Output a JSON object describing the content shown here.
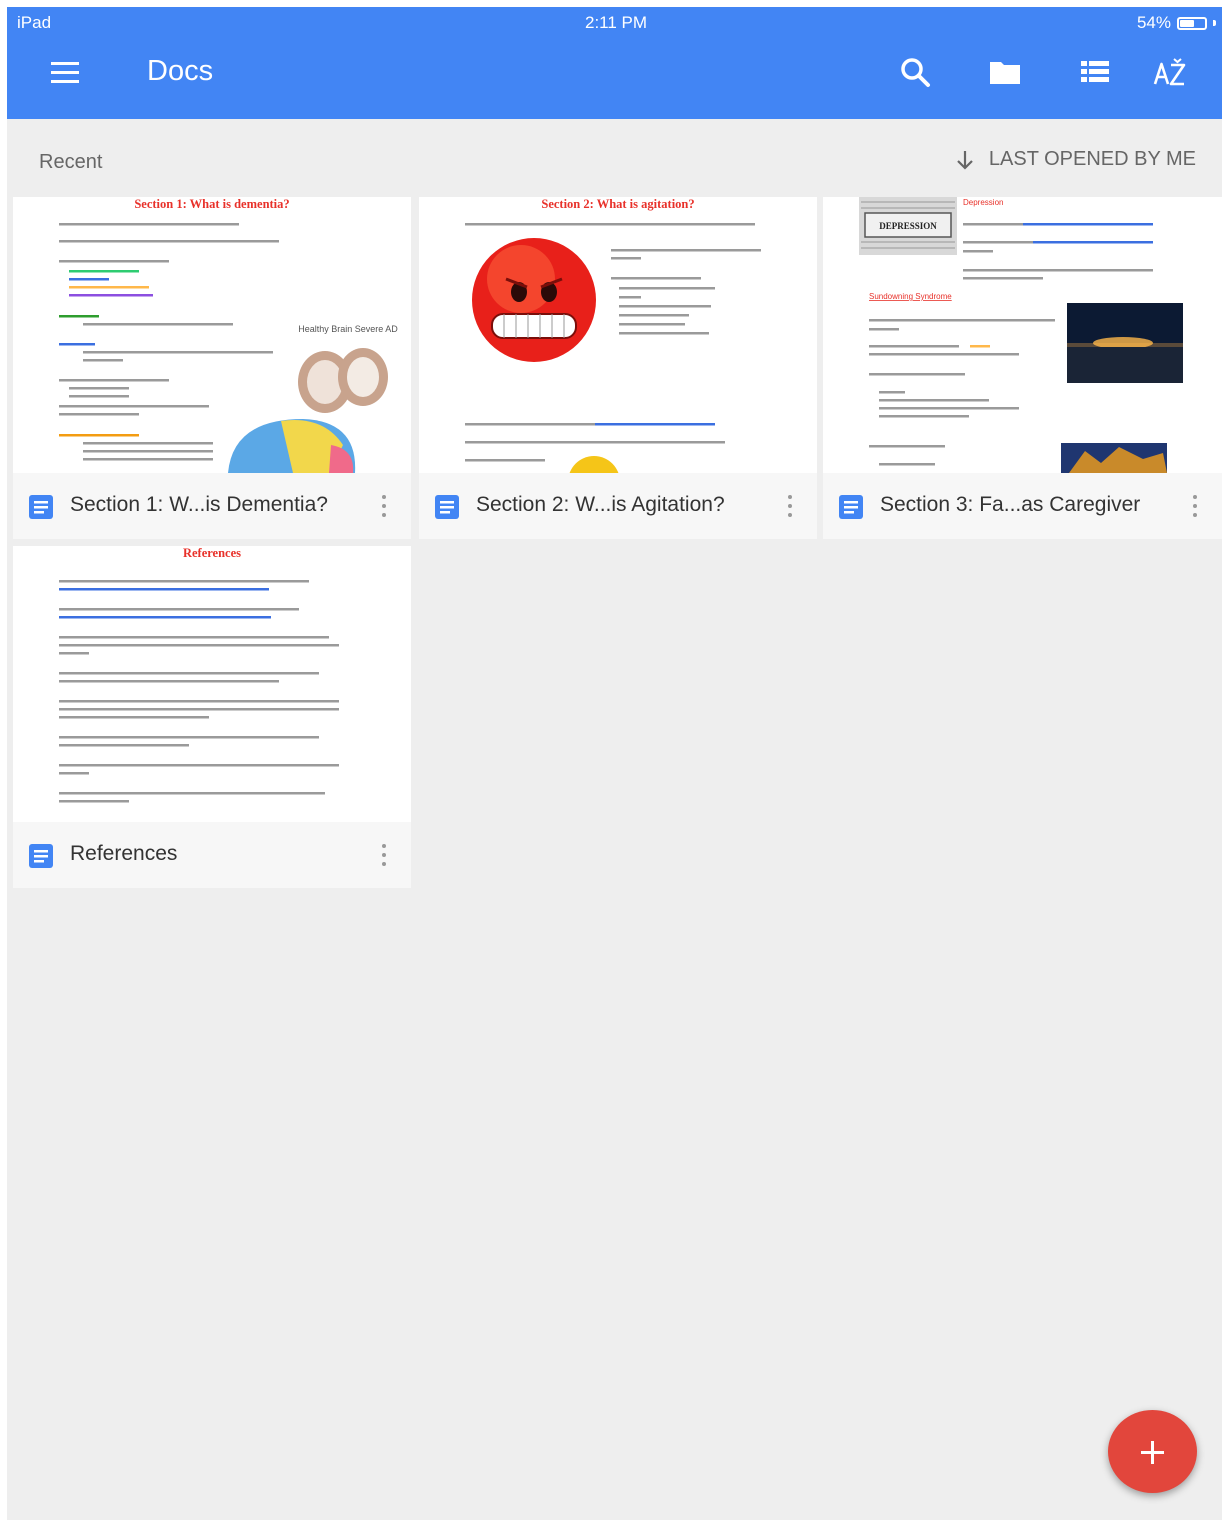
{
  "status_bar": {
    "device": "iPad",
    "time": "2:11 PM",
    "battery": "54%",
    "battery_level": 0.54
  },
  "topbar": {
    "title": "Docs",
    "icons": [
      "menu-icon",
      "search-icon",
      "folder-icon",
      "list-view-icon",
      "sort-az-icon"
    ]
  },
  "subheader": {
    "section_label": "Recent",
    "sort_label": "LAST OPENED BY ME",
    "sort_icon": "arrow-down-icon"
  },
  "documents": [
    {
      "title": "Section 1: W...is Dementia?",
      "preview_heading": "Section 1: What is dementia?",
      "preview_image_label": "Healthy Brain   Severe AD"
    },
    {
      "title": "Section 2: W...is Agitation?",
      "preview_heading": "Section 2: What is agitation?"
    },
    {
      "title": "Section 3: Fa...as Caregiver",
      "preview_heading": "Depression",
      "preview_image_label": "DEPRESSION",
      "preview_subheading": "Sundowning Syndrome"
    },
    {
      "title": "References",
      "preview_heading": "References"
    }
  ],
  "fab": {
    "icon": "plus-icon"
  },
  "colors": {
    "app_bar": "#4285f4",
    "fab": "#e2463c",
    "doc_icon": "#4285f4",
    "background": "#eeeeee"
  }
}
